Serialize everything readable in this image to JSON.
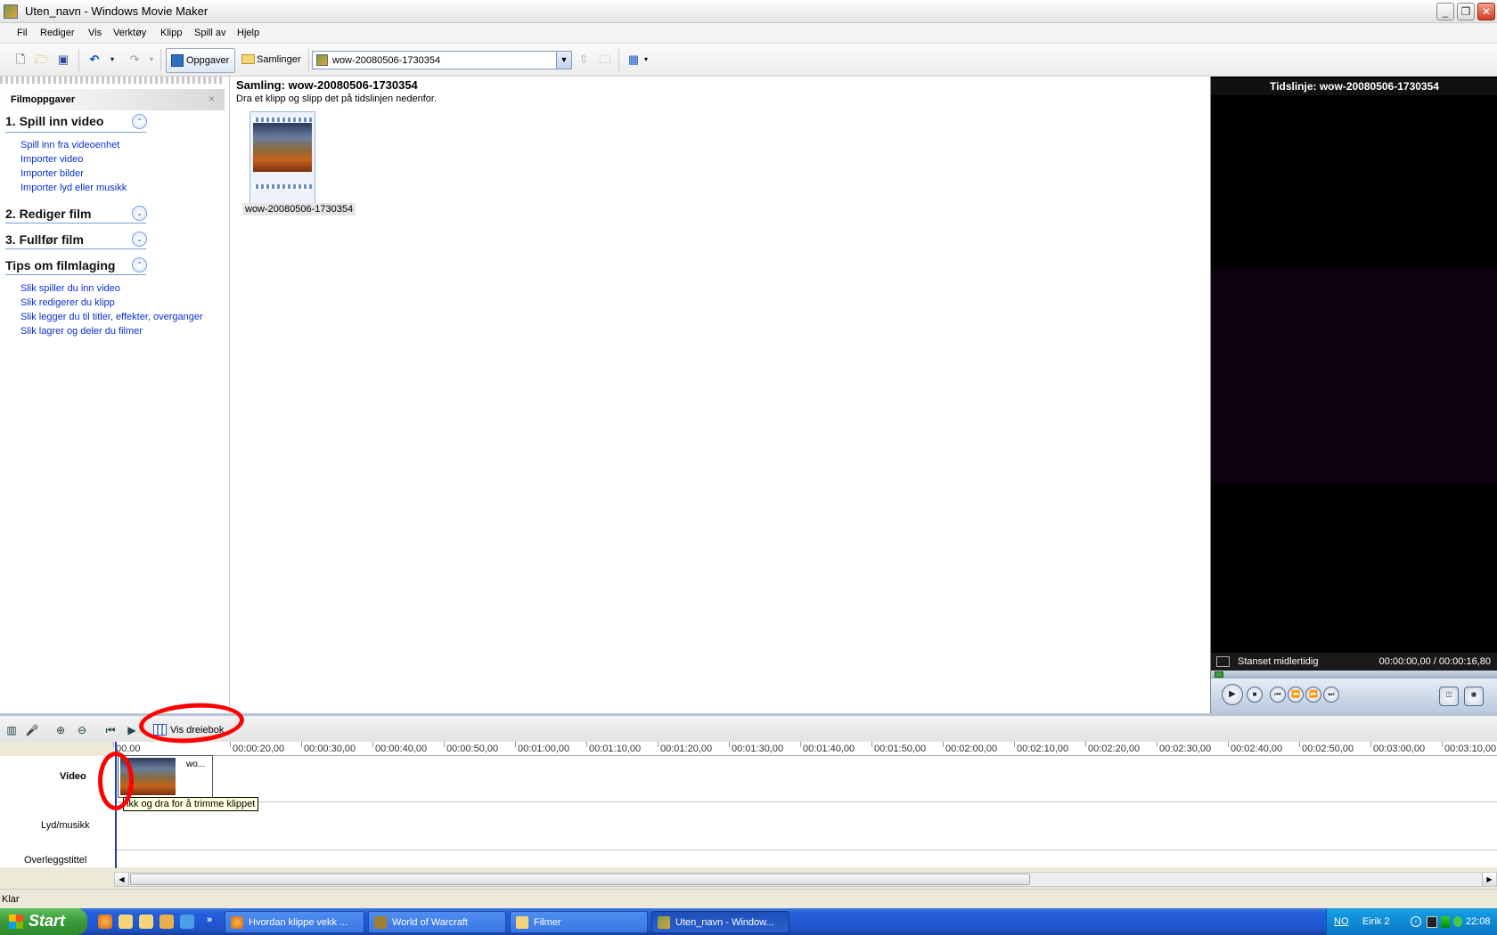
{
  "window": {
    "title": "Uten_navn - Windows Movie Maker",
    "min_label": "_",
    "max_label": "❐",
    "close_label": "✕"
  },
  "menu": [
    "Fil",
    "Rediger",
    "Vis",
    "Verktøy",
    "Klipp",
    "Spill av",
    "Hjelp"
  ],
  "toolbar": {
    "tasks_label": "Oppgaver",
    "collections_label": "Samlinger",
    "collection_value": "wow-20080506-1730354"
  },
  "taskpane": {
    "header": "Filmoppgaver",
    "close": "×",
    "sections": [
      {
        "title": "1. Spill inn video",
        "toggle": "⌃",
        "links": [
          "Spill inn fra videoenhet",
          "Importer video",
          "Importer bilder",
          "Importer lyd eller musikk"
        ]
      },
      {
        "title": "2. Rediger film",
        "toggle": "⌄",
        "links": []
      },
      {
        "title": "3. Fullfør film",
        "toggle": "⌄",
        "links": []
      },
      {
        "title": "Tips om filmlaging",
        "toggle": "⌃",
        "links": [
          "Slik spiller du inn video",
          "Slik redigerer du klipp",
          "Slik legger du til titler, effekter, overganger",
          "Slik lagrer og deler du filmer"
        ]
      }
    ]
  },
  "collection": {
    "title": "Samling: wow-20080506-1730354",
    "subtitle": "Dra et klipp og slipp det på tidslinjen nedenfor.",
    "clip_label": "wow-20080506-1730354"
  },
  "preview": {
    "title": "Tidslinje: wow-20080506-1730354",
    "status": "Stanset midlertidig",
    "time": "00:00:00,00 / 00:00:16,80",
    "progress": 0.0
  },
  "timeline": {
    "storyboard_button": "Vis dreiebok",
    "ruler": [
      "00,00",
      "00:00:20,00",
      "00:00:30,00",
      "00:00:40,00",
      "00:00:50,00",
      "00:01:00,00",
      "00:01:10,00",
      "00:01:20,00",
      "00:01:30,00",
      "00:01:40,00",
      "00:01:50,00",
      "00:02:00,00",
      "00:02:10,00",
      "00:02:20,00",
      "00:02:30,00",
      "00:02:40,00",
      "00:02:50,00",
      "00:03:00,00",
      "00:03:10,00"
    ],
    "tracks": [
      "Video",
      "Lyd/musikk",
      "Overleggstittel"
    ],
    "clip_label": "wo...",
    "tooltip": "ikk og dra for å trimme klippet"
  },
  "status": {
    "text": "Klar"
  },
  "taskbar": {
    "start": "Start",
    "tasks": [
      "Hvordan klippe vekk ...",
      "World of Warcraft",
      "Filmer",
      "Uten_navn - Window..."
    ],
    "tray": {
      "lang": "NO",
      "user": "Eirik 2",
      "clock": "22:08"
    }
  }
}
